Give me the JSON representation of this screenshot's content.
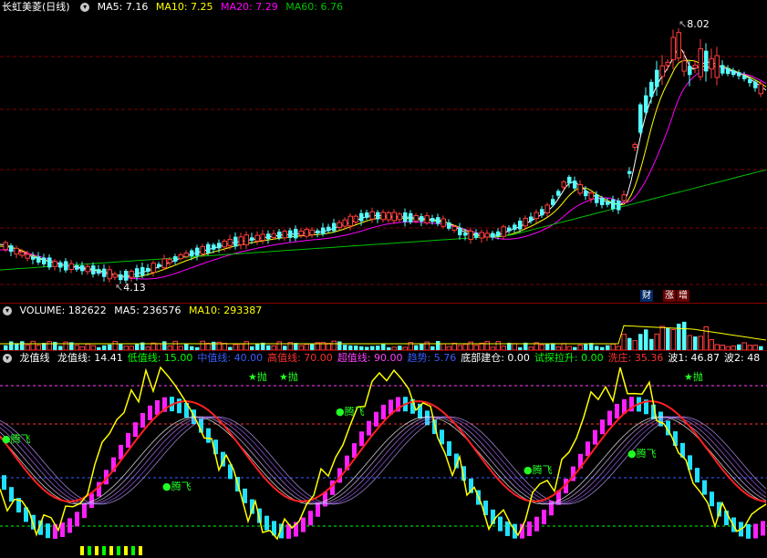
{
  "main": {
    "title": "长虹美菱(日线)",
    "ma5_label": "MA5:",
    "ma5_value": "7.16",
    "ma10_label": "MA10:",
    "ma10_value": "7.25",
    "ma20_label": "MA20:",
    "ma20_value": "7.29",
    "ma60_label": "MA60:",
    "ma60_value": "6.76",
    "high_marker": "8.02",
    "low_marker": "4.13",
    "badges": [
      "财",
      "涨",
      "增"
    ],
    "colors": {
      "up": "#ff3c3c",
      "down": "#54ffff",
      "ma5": "#ffffff",
      "ma10": "#ffff00",
      "ma20": "#ff00ff",
      "ma60": "#00c000"
    }
  },
  "volume": {
    "volume_label": "VOLUME:",
    "volume_value": "182622",
    "ma5_label": "MA5:",
    "ma5_value": "236576",
    "ma10_label": "MA10:",
    "ma10_value": "293387"
  },
  "indicator": {
    "name": "龙值线",
    "items": [
      {
        "label": "龙值线:",
        "value": "14.41",
        "color": "#ffffff"
      },
      {
        "label": "低值线:",
        "value": "15.00",
        "color": "#00ff00"
      },
      {
        "label": "中值线:",
        "value": "40.00",
        "color": "#3a5cff"
      },
      {
        "label": "高值线:",
        "value": "70.00",
        "color": "#ff3030"
      },
      {
        "label": "超值线:",
        "value": "90.00",
        "color": "#ff40ff"
      },
      {
        "label": "趋势:",
        "value": "5.76",
        "color": "#3a5cff"
      },
      {
        "label": "底部建仓:",
        "value": "0.00",
        "color": "#ffffff"
      },
      {
        "label": "试探拉升:",
        "value": "0.00",
        "color": "#00ff00"
      },
      {
        "label": "洗庄:",
        "value": "35.36",
        "color": "#ff3030"
      },
      {
        "label": "波1:",
        "value": "46.87",
        "color": "#ffffff"
      },
      {
        "label": "波2:",
        "value": "48",
        "color": "#ffffff"
      }
    ],
    "signals": [
      {
        "text": "★抛",
        "color": "#22ff22"
      },
      {
        "text": "★抛",
        "color": "#22ff22"
      },
      {
        "text": "★抛",
        "color": "#22ff22"
      },
      {
        "text": "●腾飞",
        "color": "#22ff22"
      },
      {
        "text": "●腾飞",
        "color": "#22ff22"
      },
      {
        "text": "●腾飞",
        "color": "#22ff22"
      },
      {
        "text": "●腾飞",
        "color": "#22ff22"
      },
      {
        "text": "●腾飞",
        "color": "#22ff22"
      }
    ]
  }
}
